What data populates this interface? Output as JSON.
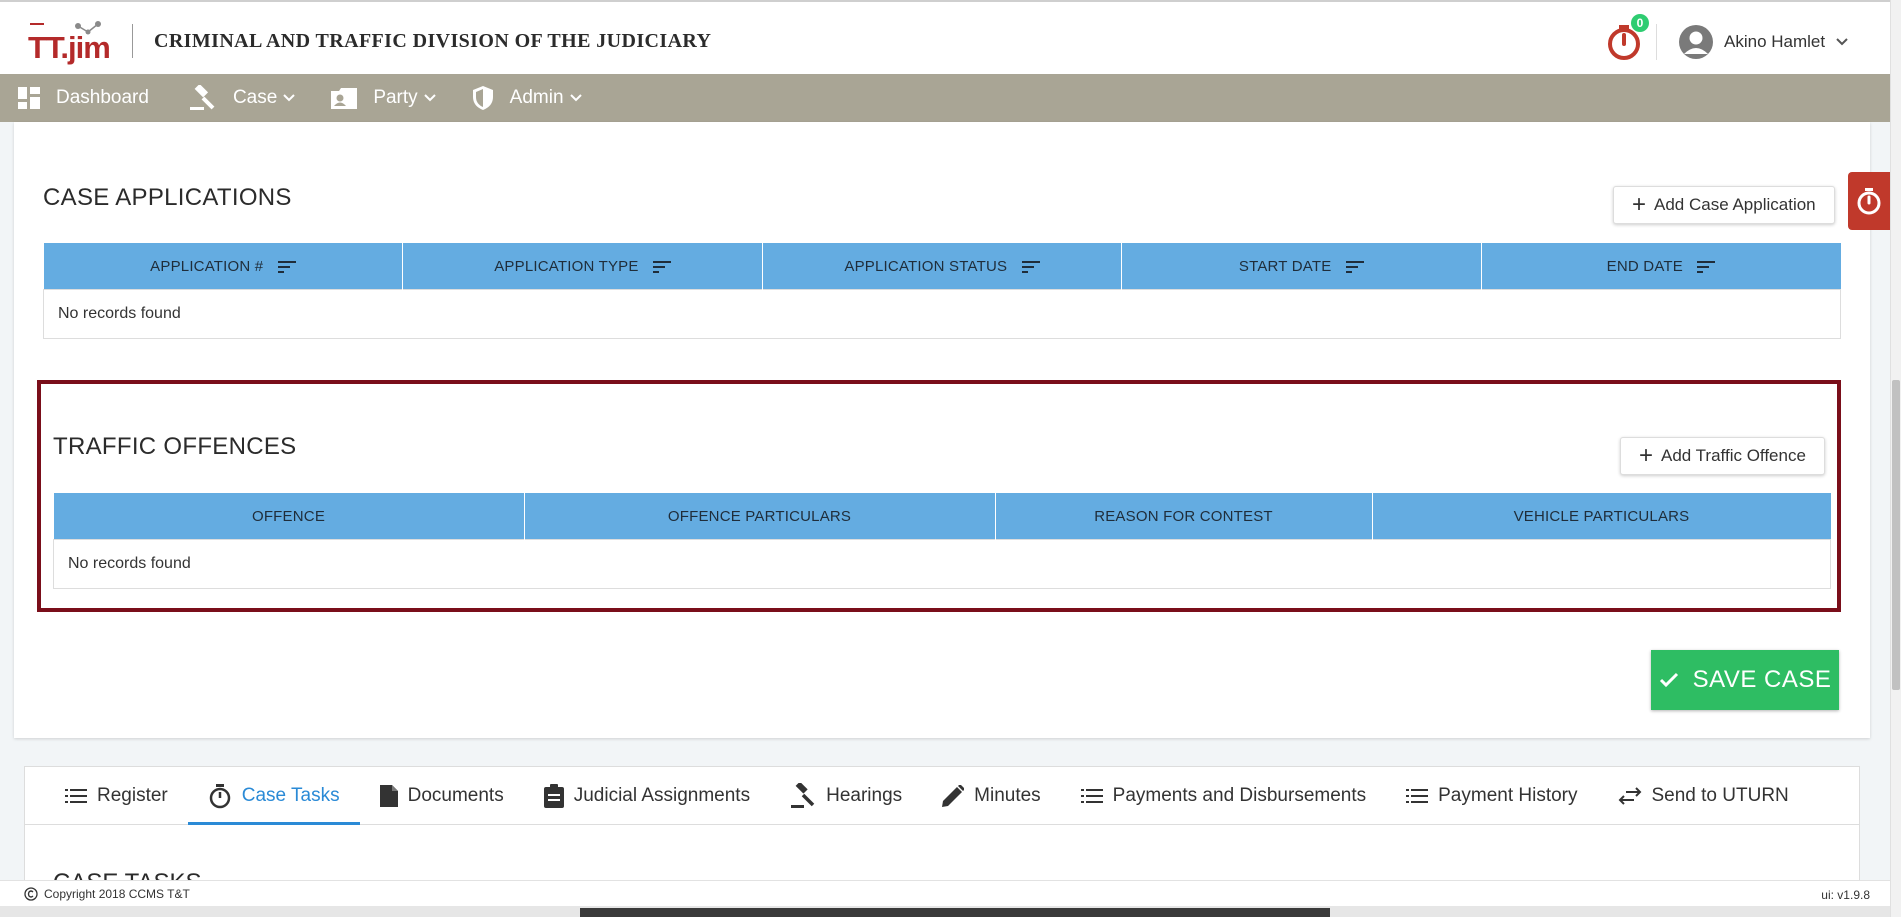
{
  "header": {
    "logo_text": "TT.jim",
    "app_title": "CRIMINAL AND TRAFFIC DIVISION OF THE JUDICIARY",
    "timer_badge": "0",
    "user_name": "Akino Hamlet"
  },
  "navbar": {
    "items": [
      {
        "label": "Dashboard",
        "icon": "dashboard-icon"
      },
      {
        "label": "Case",
        "icon": "gavel-icon"
      },
      {
        "label": "Party",
        "icon": "contact-card-icon"
      },
      {
        "label": "Admin",
        "icon": "shield-icon"
      }
    ]
  },
  "case_applications": {
    "title": "CASE APPLICATIONS",
    "add_label": "Add Case Application",
    "columns": [
      "APPLICATION #",
      "APPLICATION TYPE",
      "APPLICATION STATUS",
      "START DATE",
      "END DATE"
    ],
    "empty_text": "No records found"
  },
  "traffic_offences": {
    "title": "TRAFFIC OFFENCES",
    "add_label": "Add Traffic Offence",
    "columns": [
      "OFFENCE",
      "OFFENCE PARTICULARS",
      "REASON FOR CONTEST",
      "VEHICLE PARTICULARS"
    ],
    "empty_text": "No records found"
  },
  "save_label": "SAVE CASE",
  "tabs": [
    {
      "label": "Register",
      "icon": "list-icon"
    },
    {
      "label": "Case Tasks",
      "icon": "timer-icon",
      "active": true
    },
    {
      "label": "Documents",
      "icon": "document-icon"
    },
    {
      "label": "Judicial Assignments",
      "icon": "clipboard-icon"
    },
    {
      "label": "Hearings",
      "icon": "gavel-icon"
    },
    {
      "label": "Minutes",
      "icon": "pencil-icon"
    },
    {
      "label": "Payments and Disbursements",
      "icon": "list-icon"
    },
    {
      "label": "Payment History",
      "icon": "list-icon"
    },
    {
      "label": "Send to UTURN",
      "icon": "transfer-icon"
    }
  ],
  "tasks_heading": "CASE TASKS",
  "footer": {
    "copyright": "Copyright 2018  CCMS T&T",
    "version": "ui: v1.9.8"
  },
  "colors": {
    "navbar": "#a9a595",
    "table_header": "#64ace1",
    "highlight_border": "#7a0e1a",
    "save_button": "#2ebd63",
    "active_tab": "#2a8ad6",
    "brand_red": "#b42a2a"
  }
}
